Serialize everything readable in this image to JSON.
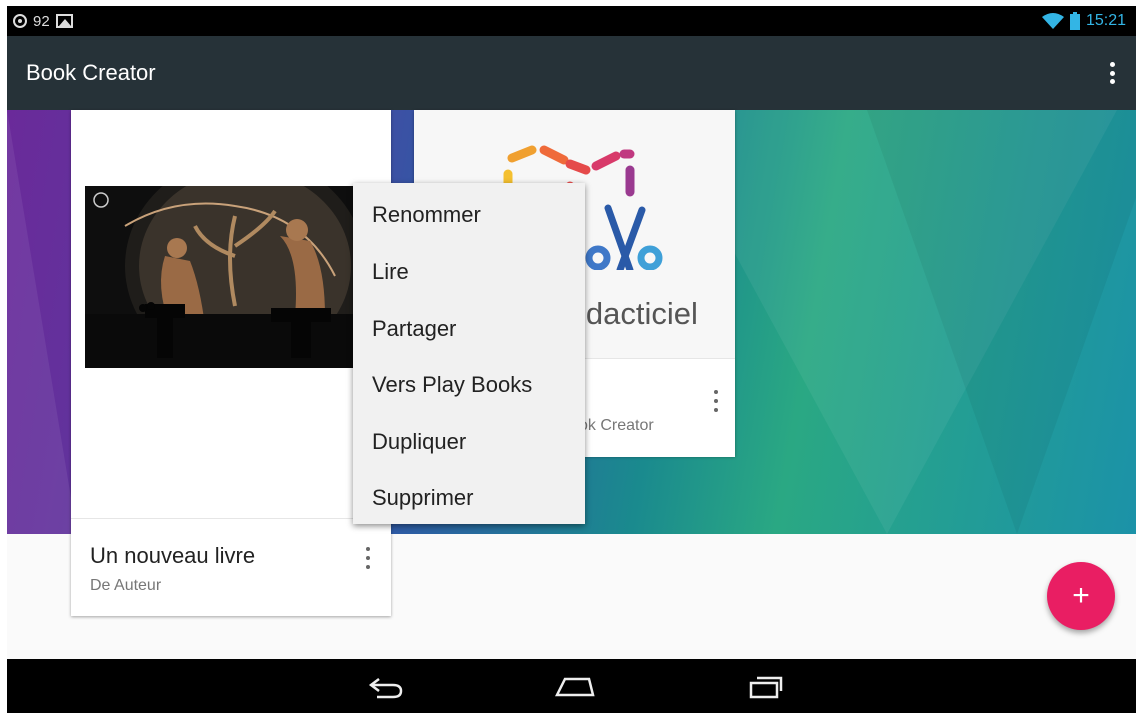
{
  "status_bar": {
    "notification_count": "92",
    "time": "15:21",
    "icons": [
      "notification-circle-icon",
      "image-icon",
      "wifi-icon",
      "battery-icon"
    ]
  },
  "app_bar": {
    "title": "Book Creator",
    "overflow_icon": "overflow-menu-icon"
  },
  "books": [
    {
      "title": "Un nouveau livre",
      "author": "De Auteur"
    },
    {
      "title": "",
      "cover_text": "idacticiel",
      "author": "ok Creator"
    }
  ],
  "context_menu": {
    "items": [
      "Renommer",
      "Lire",
      "Partager",
      "Vers Play Books",
      "Dupliquer",
      "Supprimer"
    ]
  },
  "fab": {
    "label": "+",
    "color": "#e91e63"
  },
  "nav_bar": {
    "icons": [
      "back-icon",
      "home-icon",
      "recents-icon"
    ]
  },
  "colors": {
    "app_bar": "#263238",
    "status_time": "#33b5e5",
    "fab": "#e91e63"
  }
}
